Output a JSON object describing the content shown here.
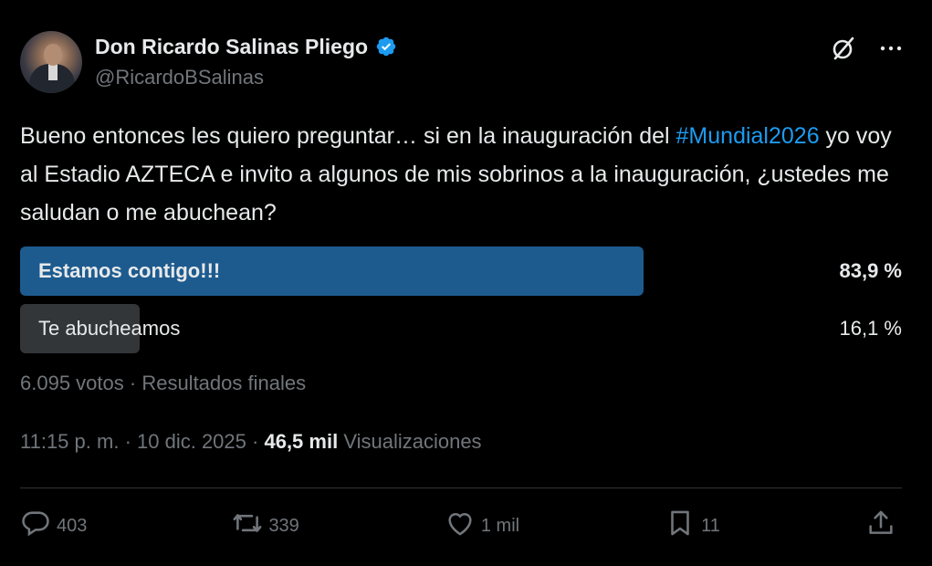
{
  "author": {
    "name": "Don Ricardo Salinas Pliego",
    "handle": "@RicardoBSalinas"
  },
  "tweet": {
    "text_before_hashtag": "Bueno entonces les quiero preguntar… si en la inauguración del ",
    "hashtag": "#Mundial2026",
    "text_after_hashtag": " yo voy al Estadio AZTECA e invito a algunos de mis sobrinos a la inauguración, ¿ustedes me saludan o me abuchean?"
  },
  "poll": {
    "options": [
      {
        "label": "Estamos contigo!!!",
        "percent_text": "83,9 %",
        "percent": 83.9,
        "winner": true
      },
      {
        "label": "Te abucheamos",
        "percent_text": "16,1 %",
        "percent": 16.1,
        "winner": false
      }
    ],
    "votes": "6.095 votos",
    "separator": "·",
    "status": "Resultados finales"
  },
  "meta": {
    "time": "11:15 p. m.",
    "sep1": "·",
    "date": "10 dic. 2025",
    "sep2": "·",
    "views_count": "46,5 mil",
    "views_label": "Visualizaciones"
  },
  "actions": {
    "replies": "403",
    "reposts": "339",
    "likes": "1 mil",
    "bookmarks": "11"
  },
  "icons": {
    "verified": "verified-badge-icon",
    "grok": "grok-icon",
    "more": "more-icon",
    "reply": "reply-icon",
    "repost": "repost-icon",
    "like": "like-icon",
    "bookmark": "bookmark-icon",
    "share": "share-icon"
  },
  "colors": {
    "background": "#000000",
    "text": "#e7e9ea",
    "muted": "#71767b",
    "accent": "#1d9bf0",
    "poll_winner": "#1d5b8f",
    "poll_loser": "#333639"
  }
}
